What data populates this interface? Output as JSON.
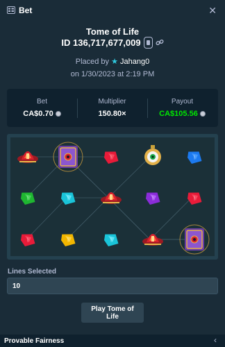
{
  "header": {
    "title": "Bet",
    "close_icon": "close-icon",
    "bet_icon": "bet-slip-icon"
  },
  "bet": {
    "game": "Tome of Life",
    "id": "ID 136,717,677,009",
    "placed_by_prefix": "Placed by",
    "user": "Jahang0",
    "date": "on 1/30/2023 at 2:19 PM"
  },
  "stats": {
    "bet_label": "Bet",
    "bet_value": "CA$0.70",
    "multiplier_label": "Multiplier",
    "multiplier_value": "150.80×",
    "payout_label": "Payout",
    "payout_value": "CA$105.56"
  },
  "board": {
    "rows": [
      [
        "red-lantern",
        "tome",
        "red-gem",
        "yellow-amulet",
        "blue-gem"
      ],
      [
        "green-gem",
        "cyan-gem",
        "red-lantern",
        "purple-gem",
        "red-gem"
      ],
      [
        "red-gem",
        "yellow-gem",
        "cyan-gem",
        "red-lantern",
        "tome"
      ]
    ]
  },
  "controls": {
    "lines_label": "Lines Selected",
    "lines_value": "10",
    "play_label": "Play Tome of Life"
  },
  "footer": {
    "label": "Provable Fairness",
    "chevron": "chevron-left-icon"
  },
  "colors": {
    "background": "#1a2c38",
    "panel": "#0f212e",
    "payout_green": "#00e701",
    "accent": "#2fcbe1"
  }
}
